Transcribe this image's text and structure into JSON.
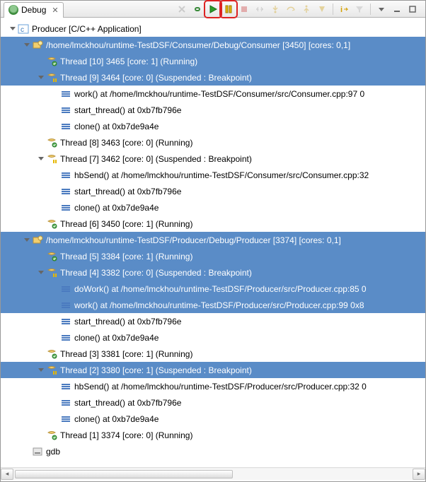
{
  "tab": {
    "title": "Debug"
  },
  "toolbar": {
    "items": [
      {
        "name": "remove-terminated-icon",
        "interact": true,
        "faded": true,
        "svg": "x-gray"
      },
      {
        "name": "connect-icon",
        "interact": true,
        "faded": false,
        "svg": "chain-green"
      },
      {
        "name": "resume-icon",
        "interact": true,
        "faded": false,
        "svg": "play-green",
        "boxed": true
      },
      {
        "name": "suspend-icon",
        "interact": true,
        "faded": false,
        "svg": "pause-yellow",
        "boxed": true
      },
      {
        "name": "terminate-icon",
        "interact": true,
        "faded": true,
        "svg": "stop-red"
      },
      {
        "name": "disconnect-icon",
        "interact": true,
        "faded": true,
        "svg": "disconnect"
      },
      {
        "name": "step-into-icon",
        "interact": true,
        "faded": true,
        "svg": "step-into"
      },
      {
        "name": "step-over-icon",
        "interact": true,
        "faded": true,
        "svg": "step-over"
      },
      {
        "name": "step-return-icon",
        "interact": true,
        "faded": true,
        "svg": "step-return"
      },
      {
        "name": "drop-frame-icon",
        "interact": true,
        "faded": true,
        "svg": "drop"
      },
      {
        "name": "sep",
        "interact": false,
        "sep": true
      },
      {
        "name": "instruction-step-icon",
        "interact": true,
        "faded": false,
        "svg": "i-arrow"
      },
      {
        "name": "use-step-filters-icon",
        "interact": true,
        "faded": true,
        "svg": "filters"
      },
      {
        "name": "sep",
        "interact": false,
        "sep": true
      },
      {
        "name": "view-menu-icon",
        "interact": true,
        "faded": false,
        "svg": "menu-tri"
      },
      {
        "name": "minimize-icon",
        "interact": true,
        "faded": false,
        "svg": "min"
      },
      {
        "name": "maximize-icon",
        "interact": true,
        "faded": false,
        "svg": "max"
      }
    ]
  },
  "tree": [
    {
      "d": 0,
      "tw": "open",
      "ic": "c-app",
      "sel": false,
      "interact": true,
      "name": "launch-config",
      "label": "Producer [C/C++ Application]"
    },
    {
      "d": 1,
      "tw": "open",
      "ic": "proc",
      "sel": true,
      "interact": true,
      "name": "process-consumer",
      "label": "/home/lmckhou/runtime-TestDSF/Consumer/Debug/Consumer [3450] [cores: 0,1]"
    },
    {
      "d": 2,
      "tw": "",
      "ic": "thread-run",
      "sel": true,
      "interact": true,
      "name": "thread-10",
      "label": "Thread [10] 3465 [core: 1] (Running)"
    },
    {
      "d": 2,
      "tw": "open",
      "ic": "thread-sus",
      "sel": true,
      "interact": true,
      "name": "thread-9",
      "label": "Thread [9] 3464 [core: 0] (Suspended : Breakpoint)"
    },
    {
      "d": 3,
      "tw": "",
      "ic": "frame",
      "sel": false,
      "interact": true,
      "name": "stack-frame",
      "label": "work() at /home/lmckhou/runtime-TestDSF/Consumer/src/Consumer.cpp:97 0"
    },
    {
      "d": 3,
      "tw": "",
      "ic": "frame",
      "sel": false,
      "interact": true,
      "name": "stack-frame",
      "label": "start_thread() at 0xb7fb796e"
    },
    {
      "d": 3,
      "tw": "",
      "ic": "frame",
      "sel": false,
      "interact": true,
      "name": "stack-frame",
      "label": "clone() at 0xb7de9a4e"
    },
    {
      "d": 2,
      "tw": "",
      "ic": "thread-run",
      "sel": false,
      "interact": true,
      "name": "thread-8",
      "label": "Thread [8] 3463 [core: 0] (Running)"
    },
    {
      "d": 2,
      "tw": "open",
      "ic": "thread-sus",
      "sel": false,
      "interact": true,
      "name": "thread-7",
      "label": "Thread [7] 3462 [core: 0] (Suspended : Breakpoint)"
    },
    {
      "d": 3,
      "tw": "",
      "ic": "frame",
      "sel": false,
      "interact": true,
      "name": "stack-frame",
      "label": "hbSend() at /home/lmckhou/runtime-TestDSF/Consumer/src/Consumer.cpp:32"
    },
    {
      "d": 3,
      "tw": "",
      "ic": "frame",
      "sel": false,
      "interact": true,
      "name": "stack-frame",
      "label": "start_thread() at 0xb7fb796e"
    },
    {
      "d": 3,
      "tw": "",
      "ic": "frame",
      "sel": false,
      "interact": true,
      "name": "stack-frame",
      "label": "clone() at 0xb7de9a4e"
    },
    {
      "d": 2,
      "tw": "",
      "ic": "thread-run",
      "sel": false,
      "interact": true,
      "name": "thread-6",
      "label": "Thread [6] 3450 [core: 1] (Running)"
    },
    {
      "d": 1,
      "tw": "open",
      "ic": "proc",
      "sel": true,
      "interact": true,
      "name": "process-producer",
      "label": "/home/lmckhou/runtime-TestDSF/Producer/Debug/Producer [3374] [cores: 0,1]"
    },
    {
      "d": 2,
      "tw": "",
      "ic": "thread-run",
      "sel": true,
      "interact": true,
      "name": "thread-5",
      "label": "Thread [5] 3384 [core: 1] (Running)"
    },
    {
      "d": 2,
      "tw": "open",
      "ic": "thread-sus",
      "sel": true,
      "interact": true,
      "name": "thread-4",
      "label": "Thread [4] 3382 [core: 0] (Suspended : Breakpoint)"
    },
    {
      "d": 3,
      "tw": "",
      "ic": "frame",
      "sel": true,
      "interact": true,
      "name": "stack-frame",
      "label": "doWork() at /home/lmckhou/runtime-TestDSF/Producer/src/Producer.cpp:85 0"
    },
    {
      "d": 3,
      "tw": "",
      "ic": "frame",
      "sel": true,
      "interact": true,
      "name": "stack-frame",
      "label": "work() at /home/lmckhou/runtime-TestDSF/Producer/src/Producer.cpp:99 0x8"
    },
    {
      "d": 3,
      "tw": "",
      "ic": "frame",
      "sel": false,
      "interact": true,
      "name": "stack-frame",
      "label": "start_thread() at 0xb7fb796e"
    },
    {
      "d": 3,
      "tw": "",
      "ic": "frame",
      "sel": false,
      "interact": true,
      "name": "stack-frame",
      "label": "clone() at 0xb7de9a4e"
    },
    {
      "d": 2,
      "tw": "",
      "ic": "thread-run",
      "sel": false,
      "interact": true,
      "name": "thread-3",
      "label": "Thread [3] 3381 [core: 1] (Running)"
    },
    {
      "d": 2,
      "tw": "open",
      "ic": "thread-sus",
      "sel": true,
      "interact": true,
      "name": "thread-2",
      "label": "Thread [2] 3380 [core: 1] (Suspended : Breakpoint)"
    },
    {
      "d": 3,
      "tw": "",
      "ic": "frame",
      "sel": false,
      "interact": true,
      "name": "stack-frame",
      "label": "hbSend() at /home/lmckhou/runtime-TestDSF/Producer/src/Producer.cpp:32 0"
    },
    {
      "d": 3,
      "tw": "",
      "ic": "frame",
      "sel": false,
      "interact": true,
      "name": "stack-frame",
      "label": "start_thread() at 0xb7fb796e"
    },
    {
      "d": 3,
      "tw": "",
      "ic": "frame",
      "sel": false,
      "interact": true,
      "name": "stack-frame",
      "label": "clone() at 0xb7de9a4e"
    },
    {
      "d": 2,
      "tw": "",
      "ic": "thread-run",
      "sel": false,
      "interact": true,
      "name": "thread-1",
      "label": "Thread [1] 3374 [core: 0] (Running)"
    },
    {
      "d": 1,
      "tw": "",
      "ic": "gdb",
      "sel": false,
      "interact": true,
      "name": "gdb-process",
      "label": "gdb"
    }
  ]
}
